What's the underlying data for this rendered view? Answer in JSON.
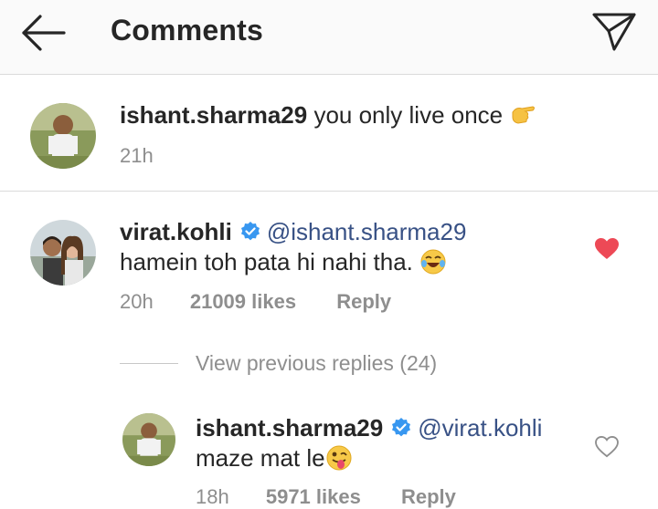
{
  "header": {
    "title": "Comments"
  },
  "comments": [
    {
      "username": "ishant.sharma29",
      "text": "you only live once",
      "time": "21h"
    },
    {
      "username": "virat.kohli",
      "mention": "@ishant.sharma29",
      "text": "hamein toh pata hi nahi tha.",
      "time": "20h",
      "likes": "21009 likes",
      "reply_label": "Reply",
      "liked": true
    }
  ],
  "view_replies": "View previous replies (24)",
  "reply": {
    "username": "ishant.sharma29",
    "mention": "@virat.kohli",
    "text": "maze mat le",
    "time": "18h",
    "likes": "5971 likes",
    "reply_label": "Reply",
    "liked": false
  },
  "colors": {
    "header_bg": "#fafafa",
    "text": "#262626",
    "muted": "#8e8e8e",
    "mention": "#385185",
    "liked_heart": "#ed4956",
    "verified": "#3897f0"
  },
  "icons": {
    "back": "arrow-left-icon",
    "send": "paper-plane-icon",
    "verified": "verified-badge-icon",
    "like": "heart-icon"
  }
}
